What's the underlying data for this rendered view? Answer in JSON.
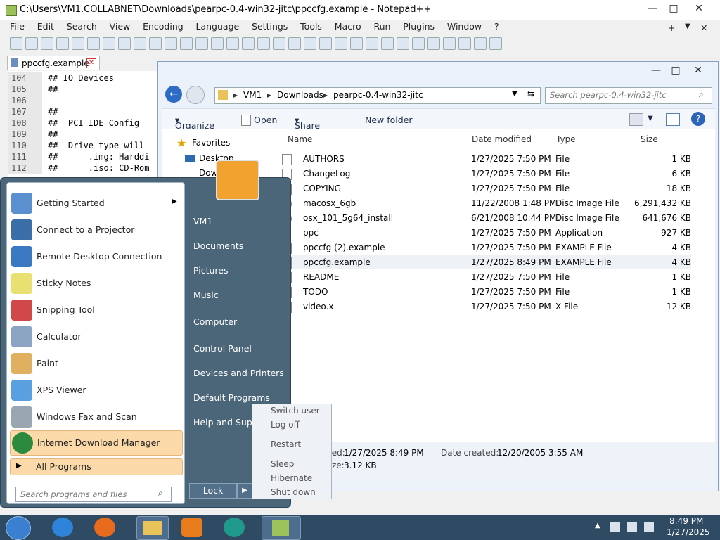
{
  "notepad": {
    "title": "C:\\Users\\VM1.COLLABNET\\Downloads\\pearpc-0.4-win32-jitc\\ppccfg.example - Notepad++",
    "win_controls": [
      "—",
      "□",
      "✕"
    ],
    "menu": [
      "File",
      "Edit",
      "Search",
      "View",
      "Encoding",
      "Language",
      "Settings",
      "Tools",
      "Macro",
      "Run",
      "Plugins",
      "Window",
      "?"
    ],
    "menu_right": [
      "+",
      "▼",
      "✕"
    ],
    "tab": "ppccfg.example",
    "lines": [
      {
        "n": "104",
        "t": "## IO Devices"
      },
      {
        "n": "105",
        "t": "##"
      },
      {
        "n": "106",
        "t": ""
      },
      {
        "n": "107",
        "t": "##"
      },
      {
        "n": "108",
        "t": "##  PCI IDE Config"
      },
      {
        "n": "109",
        "t": "##"
      },
      {
        "n": "110",
        "t": "##  Drive type will"
      },
      {
        "n": "111",
        "t": "##      .img: Harddi"
      },
      {
        "n": "112",
        "t": "##      .iso: CD-Rom"
      }
    ]
  },
  "explorer": {
    "breadcrumb": [
      "VM1",
      "Downloads",
      "pearpc-0.4-win32-jitc"
    ],
    "search_placeholder": "Search pearpc-0.4-win32-jitc",
    "commands": {
      "organize": "Organize",
      "open": "Open",
      "share": "Share with",
      "new_folder": "New folder"
    },
    "nav": {
      "favorites": "Favorites",
      "desktop": "Desktop",
      "downloads": "Dow"
    },
    "headers": {
      "name": "Name",
      "date": "Date modified",
      "type": "Type",
      "size": "Size"
    },
    "files": [
      {
        "name": "AUTHORS",
        "date": "1/27/2025 7:50 PM",
        "type": "File",
        "size": "1 KB"
      },
      {
        "name": "ChangeLog",
        "date": "1/27/2025 7:50 PM",
        "type": "File",
        "size": "6 KB"
      },
      {
        "name": "COPYING",
        "date": "1/27/2025 7:50 PM",
        "type": "File",
        "size": "18 KB"
      },
      {
        "name": "macosx_6gb",
        "date": "11/22/2008 1:48 PM",
        "type": "Disc Image File",
        "size": "6,291,432 KB"
      },
      {
        "name": "osx_101_5g64_install",
        "date": "6/21/2008 10:44 PM",
        "type": "Disc Image File",
        "size": "641,676 KB"
      },
      {
        "name": "ppc",
        "date": "1/27/2025 7:50 PM",
        "type": "Application",
        "size": "927 KB"
      },
      {
        "name": "ppccfg (2).example",
        "date": "1/27/2025 7:50 PM",
        "type": "EXAMPLE File",
        "size": "4 KB"
      },
      {
        "name": "ppccfg.example",
        "date": "1/27/2025 8:49 PM",
        "type": "EXAMPLE File",
        "size": "4 KB"
      },
      {
        "name": "README",
        "date": "1/27/2025 7:50 PM",
        "type": "File",
        "size": "1 KB"
      },
      {
        "name": "TODO",
        "date": "1/27/2025 7:50 PM",
        "type": "File",
        "size": "1 KB"
      },
      {
        "name": "video.x",
        "date": "1/27/2025 7:50 PM",
        "type": "X File",
        "size": "12 KB"
      }
    ],
    "details": {
      "modified_label": "ate modified:",
      "modified": "1/27/2025 8:49 PM",
      "created_label": "Date created:",
      "created": "12/20/2005 3:55 AM",
      "size_label": "Size:",
      "size": "3.12 KB"
    }
  },
  "start_menu": {
    "programs": [
      "Getting Started",
      "Connect to a Projector",
      "Remote Desktop Connection",
      "Sticky Notes",
      "Snipping Tool",
      "Calculator",
      "Paint",
      "XPS Viewer",
      "Windows Fax and Scan",
      "Internet Download Manager"
    ],
    "all_programs": "All Programs",
    "search_placeholder": "Search programs and files",
    "right_items": [
      "VM1",
      "Documents",
      "Pictures",
      "Music",
      "Computer",
      "Control Panel",
      "Devices and Printers",
      "Default Programs",
      "Help and Support"
    ],
    "lock": "Lock",
    "power_menu": [
      "Switch user",
      "Log off",
      "Restart",
      "Sleep",
      "Hibernate",
      "Shut down"
    ]
  },
  "taskbar": {
    "time": "8:49 PM",
    "date": "1/27/2025"
  }
}
